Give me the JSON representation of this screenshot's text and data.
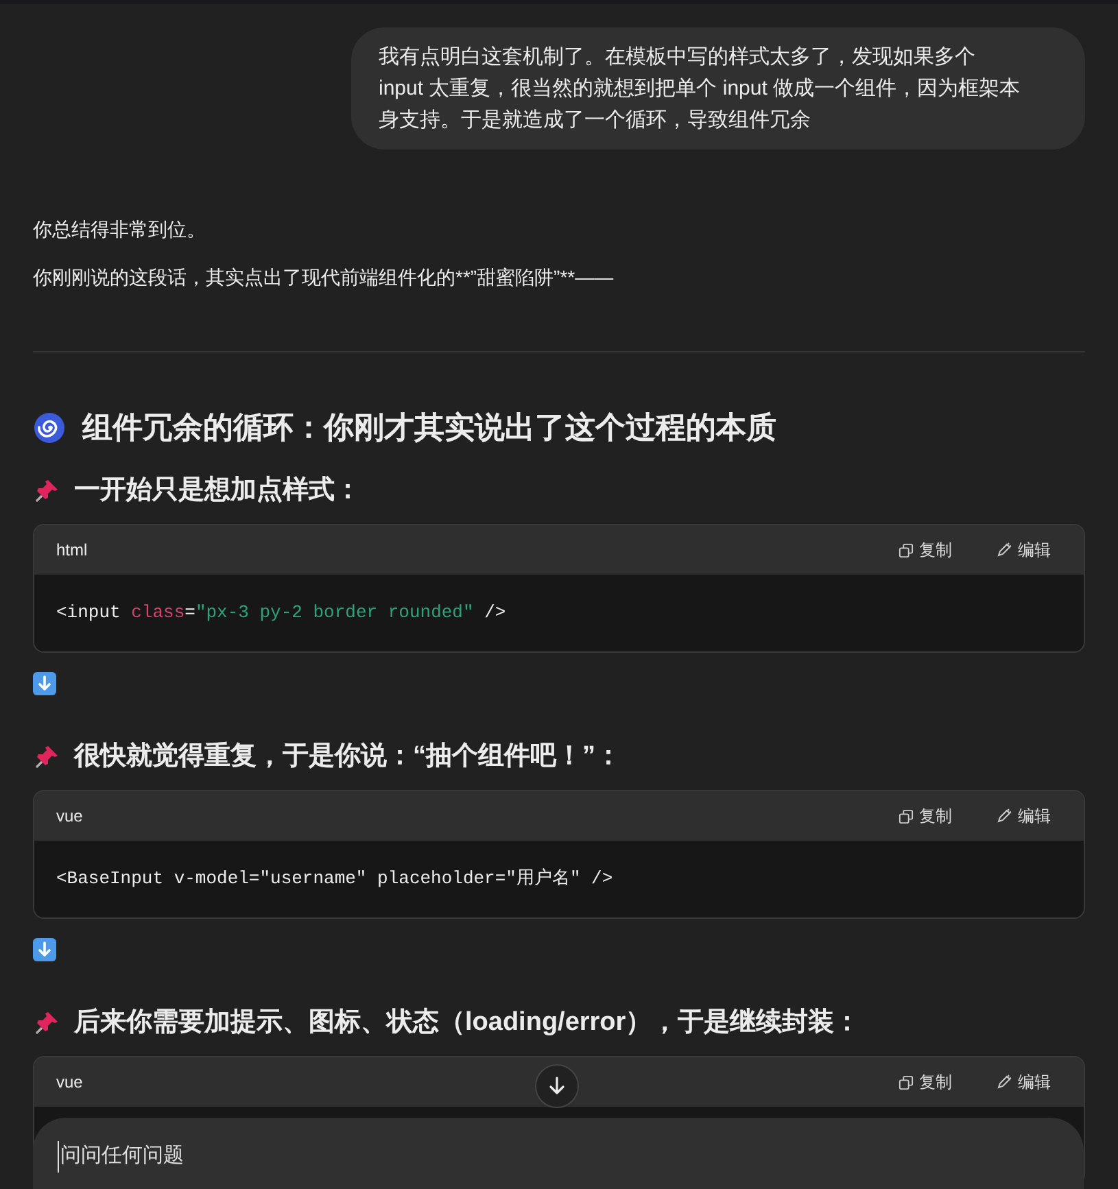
{
  "user_message": "我有点明白这套机制了。在模板中写的样式太多了，发现如果多个 input 太重复，很当然的就想到把单个 input 做成一个组件，因为框架本身支持。于是就造成了一个循环，导致组件冗余",
  "reply_paragraphs": [
    "你总结得非常到位。",
    "你刚刚说的这段话，其实点出了现代前端组件化的**”甜蜜陷阱”**——"
  ],
  "blocks": [
    {
      "kind": "heading",
      "text": "组件冗余的循环：你刚才其实说出了这个过程的本质"
    },
    {
      "kind": "subheading",
      "text": "一开始只是想加点样式："
    },
    {
      "kind": "code",
      "language": "html",
      "copy_label": "复制",
      "edit_label": "编辑",
      "tokens": [
        {
          "kind": "plain",
          "text": "<input "
        },
        {
          "kind": "attr",
          "text": "class"
        },
        {
          "kind": "plain",
          "text": "="
        },
        {
          "kind": "string",
          "text": "\"px-3 py-2 border rounded\""
        },
        {
          "kind": "plain",
          "text": " />"
        }
      ]
    },
    {
      "kind": "arrow"
    },
    {
      "kind": "subheading",
      "text": "很快就觉得重复，于是你说：“抽个组件吧！”："
    },
    {
      "kind": "code",
      "language": "vue",
      "copy_label": "复制",
      "edit_label": "编辑",
      "tokens": [
        {
          "kind": "plain",
          "text": "<BaseInput v-model=\"username\" placeholder=\"用户名\" />"
        }
      ]
    },
    {
      "kind": "arrow"
    },
    {
      "kind": "subheading",
      "text": "后来你需要加提示、图标、状态（loading/error），于是继续封装："
    },
    {
      "kind": "code",
      "language": "vue",
      "copy_label": "复制",
      "edit_label": "编辑"
    }
  ],
  "composer": {
    "placeholder": "问问任何问题"
  }
}
